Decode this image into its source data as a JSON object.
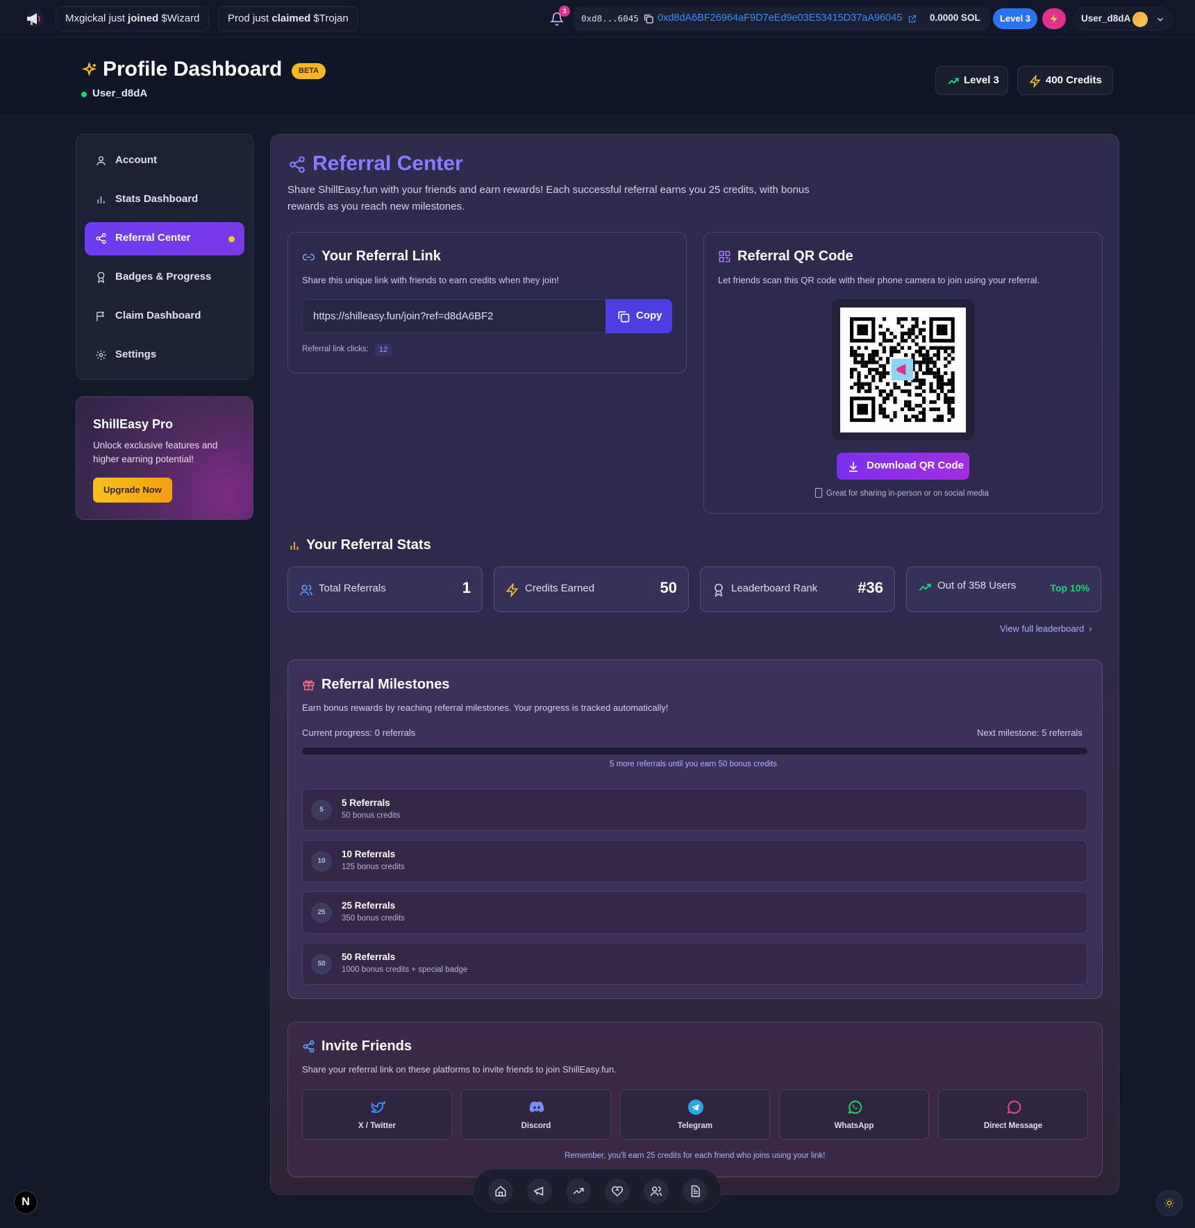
{
  "topbar": {
    "ticker1": {
      "user": "Mxgickal",
      "verb": "just",
      "action": "joined",
      "token": "$Wizard"
    },
    "ticker2": {
      "user": "Prod",
      "verb": "just",
      "action": "claimed",
      "token": "$Trojan"
    },
    "notification_count": "3",
    "wallet_short": "0xd8...6045",
    "wallet_full": "0xd8dA6BF26964aF9D7eEd9e03E53415D37aA96045",
    "balance": "0.0000 SOL",
    "level": "Level 3",
    "username": "User_d8dA"
  },
  "header": {
    "title": "Profile Dashboard",
    "badge": "BETA",
    "username": "User_d8dA",
    "level_button": "Level 3",
    "credits_button": "400 Credits"
  },
  "sidebar": {
    "items": [
      {
        "label": "Account",
        "icon": "user-icon"
      },
      {
        "label": "Stats Dashboard",
        "icon": "bar-chart-icon"
      },
      {
        "label": "Referral Center",
        "icon": "share-icon",
        "active": true
      },
      {
        "label": "Badges & Progress",
        "icon": "award-icon"
      },
      {
        "label": "Claim Dashboard",
        "icon": "flag-icon"
      },
      {
        "label": "Settings",
        "icon": "gear-icon"
      }
    ]
  },
  "pro": {
    "title": "ShillEasy Pro",
    "text": "Unlock exclusive features and higher earning potential!",
    "button": "Upgrade Now"
  },
  "referral": {
    "title": "Referral Center",
    "description": "Share ShillEasy.fun with your friends and earn rewards! Each successful referral earns you 25 credits, with bonus rewards as you reach new milestones.",
    "link_card": {
      "title": "Your Referral Link",
      "subtitle": "Share this unique link with friends to earn credits when they join!",
      "link": "https://shilleasy.fun/join?ref=d8dA6BF2",
      "copy_label": "Copy",
      "clicks_label": "Referral link clicks:",
      "clicks_value": "12"
    },
    "qr_card": {
      "title": "Referral QR Code",
      "subtitle": "Let friends scan this QR code with their phone camera to join using your referral.",
      "download_label": "Download QR Code",
      "note": "Great for sharing in-person or on social media"
    }
  },
  "stats": {
    "title": "Your Referral Stats",
    "items": [
      {
        "label": "Total Referrals",
        "value": "1"
      },
      {
        "label": "Credits Earned",
        "value": "50"
      },
      {
        "label": "Leaderboard Rank",
        "value": "#36"
      },
      {
        "label": "Out of 358 Users",
        "value": "Top 10%"
      }
    ],
    "view_leaderboard": "View full leaderboard"
  },
  "milestones": {
    "title": "Referral Milestones",
    "subtitle": "Earn bonus rewards by reaching referral milestones. Your progress is tracked automatically!",
    "current_progress": "Current progress: 0 referrals",
    "next_milestone": "Next milestone: 5 referrals",
    "progress_fraction": 0,
    "progress_hint": "5 more referrals until you earn 50 bonus credits",
    "items": [
      {
        "num": "5",
        "title": "5 Referrals",
        "reward": "50 bonus credits"
      },
      {
        "num": "10",
        "title": "10 Referrals",
        "reward": "125 bonus credits"
      },
      {
        "num": "25",
        "title": "25 Referrals",
        "reward": "350 bonus credits"
      },
      {
        "num": "50",
        "title": "50 Referrals",
        "reward": "1000 bonus credits + special badge"
      }
    ]
  },
  "invite": {
    "title": "Invite Friends",
    "subtitle": "Share your referral link on these platforms to invite friends to join ShillEasy.fun.",
    "platforms": [
      {
        "label": "X / Twitter",
        "icon": "twitter-icon",
        "color": "#3d8cf5"
      },
      {
        "label": "Discord",
        "icon": "discord-icon",
        "color": "#7c8bff"
      },
      {
        "label": "Telegram",
        "icon": "telegram-icon",
        "color": "#27a7e7"
      },
      {
        "label": "WhatsApp",
        "icon": "whatsapp-icon",
        "color": "#25d366"
      },
      {
        "label": "Direct Message",
        "icon": "message-icon",
        "color": "#ec4899"
      }
    ],
    "footer": "Remember, you'll earn 25 credits for each friend who joins using your link!"
  },
  "misc": {
    "nx_badge": "N"
  },
  "colors": {
    "accent": "#6b3df0",
    "brand_blue": "#3d8cf5",
    "title_purple": "#8b7cff",
    "success": "#24d27c",
    "warning": "#f6b81e"
  }
}
